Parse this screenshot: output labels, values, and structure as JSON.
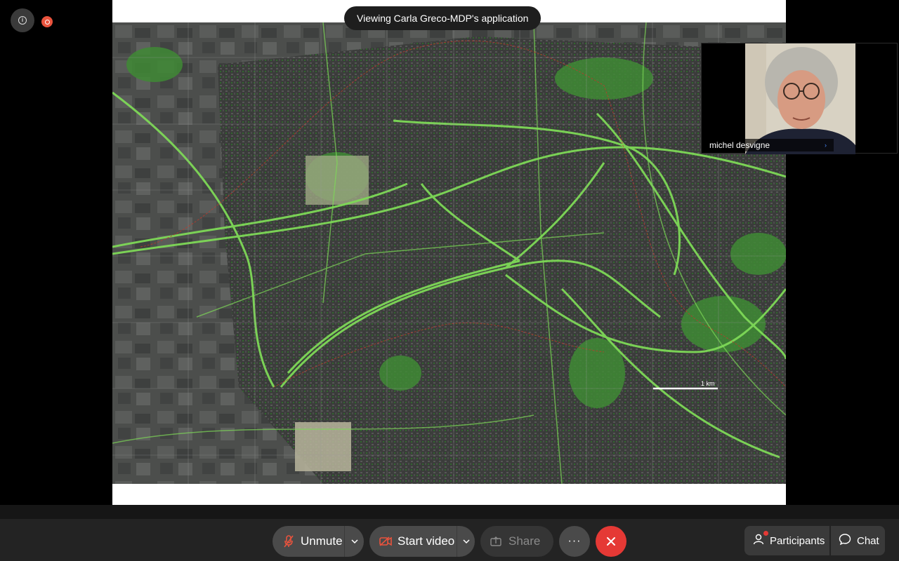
{
  "top_left": {
    "info_icon": "info-icon",
    "recording_icon": "recording-icon"
  },
  "share": {
    "banner": "Viewing Carla Greco-MDP's application",
    "map": {
      "scale_label": "1 km"
    }
  },
  "video_tile": {
    "participant_name": "michel desvigne",
    "chevron": "›"
  },
  "controls": {
    "unmute_label": "Unmute",
    "start_video_label": "Start video",
    "share_label": "Share",
    "more_label": "···",
    "participants_label": "Participants",
    "chat_label": "Chat"
  },
  "colors": {
    "end_call": "#e53935",
    "record": "#e9533d",
    "map_green": "#7ed957"
  }
}
